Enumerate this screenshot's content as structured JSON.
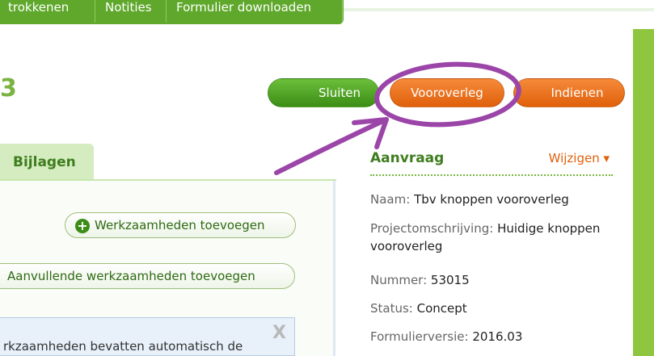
{
  "topbar": {
    "tabs": [
      "trokkenen",
      "Notities",
      "Formulier downloaden"
    ]
  },
  "header": {
    "title_fragment": "3"
  },
  "actions": {
    "close_label": "Sluiten",
    "pre_consult_label": "Vooroverleg",
    "submit_label": "Indienen"
  },
  "tabs": {
    "attachments_label": "Bijlagen"
  },
  "work": {
    "add_work_label": "Werkzaamheden toevoegen",
    "add_extra_label": "Aanvullende werkzaamheden toevoegen",
    "info_text": "rkzaamheden bevatten automatisch de",
    "close_glyph": "X"
  },
  "aside": {
    "title": "Aanvraag",
    "edit_label": "Wijzigen ▾",
    "fields": [
      {
        "label": "Naam:",
        "value": "Tbv knoppen vooroverleg"
      },
      {
        "label": "Projectomschrijving:",
        "value": "Huidige knoppen vooroverleg"
      },
      {
        "label": "Nummer:",
        "value": "53015"
      },
      {
        "label": "Status:",
        "value": "Concept"
      },
      {
        "label": "Formulierversie:",
        "value": "2016.03"
      }
    ]
  },
  "colors": {
    "green": "#5fa82b",
    "orange": "#e0600b",
    "annotation_purple": "#9b45a8"
  }
}
